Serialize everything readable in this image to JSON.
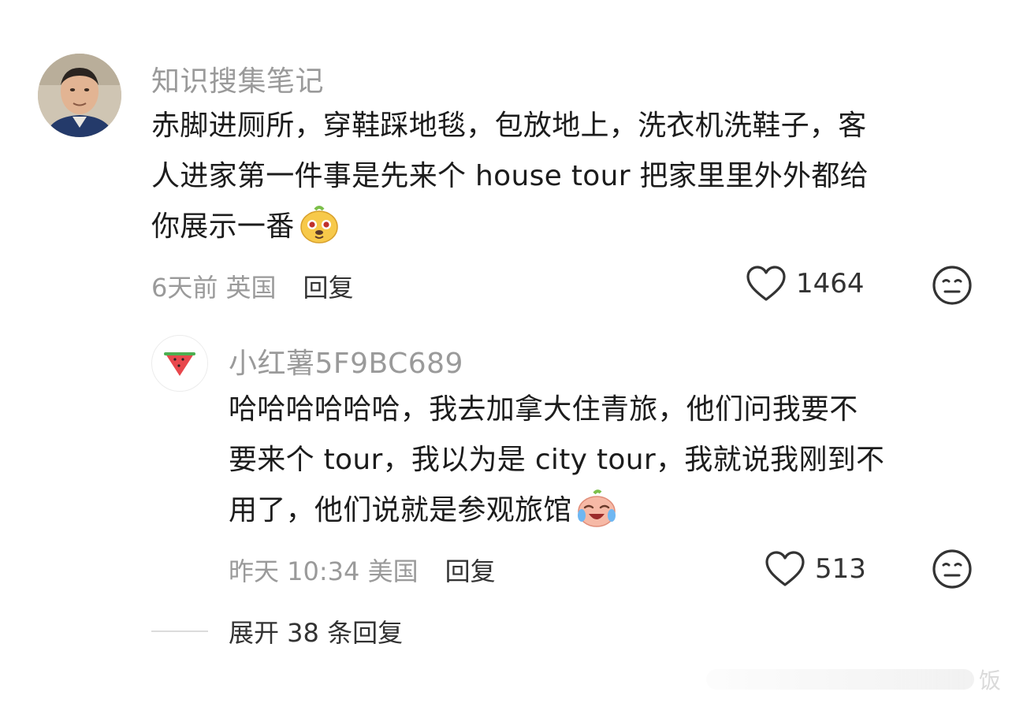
{
  "comment": {
    "username": "知识搜集笔记",
    "avatar_icon": "user-photo-avatar",
    "lines": [
      "赤脚进厕所，穿鞋踩地毯，包放地上，洗衣机洗鞋子，客",
      "人进家第一件事是先来个 house tour 把家里里外外都给",
      "你展示一番"
    ],
    "emoji_icon": "dog-face-emoji",
    "time_location": "6天前 英国",
    "reply_label": "回复",
    "like_count": "1464",
    "like_icon": "heart-outline-icon",
    "dislike_icon": "meh-face-icon"
  },
  "reply": {
    "username": "小红薯5F9BC689",
    "avatar_icon": "watermelon-avatar",
    "lines": [
      "哈哈哈哈哈哈，我去加拿大住青旅，他们问我要不",
      "要来个 tour，我以为是 city tour，我就说我刚到不",
      "用了，他们说就是参观旅馆"
    ],
    "emoji_icon": "laughing-crying-emoji",
    "time_location": "昨天 10:34 美国",
    "reply_label": "回复",
    "like_count": "513",
    "like_icon": "heart-outline-icon",
    "dislike_icon": "meh-face-icon"
  },
  "expand": {
    "label": "展开 38 条回复"
  },
  "watermark": {
    "text": "饭"
  },
  "colors": {
    "username": "#9a9a9a",
    "text": "#1c1c1c",
    "meta": "#9a9a9a",
    "action": "#333333"
  }
}
